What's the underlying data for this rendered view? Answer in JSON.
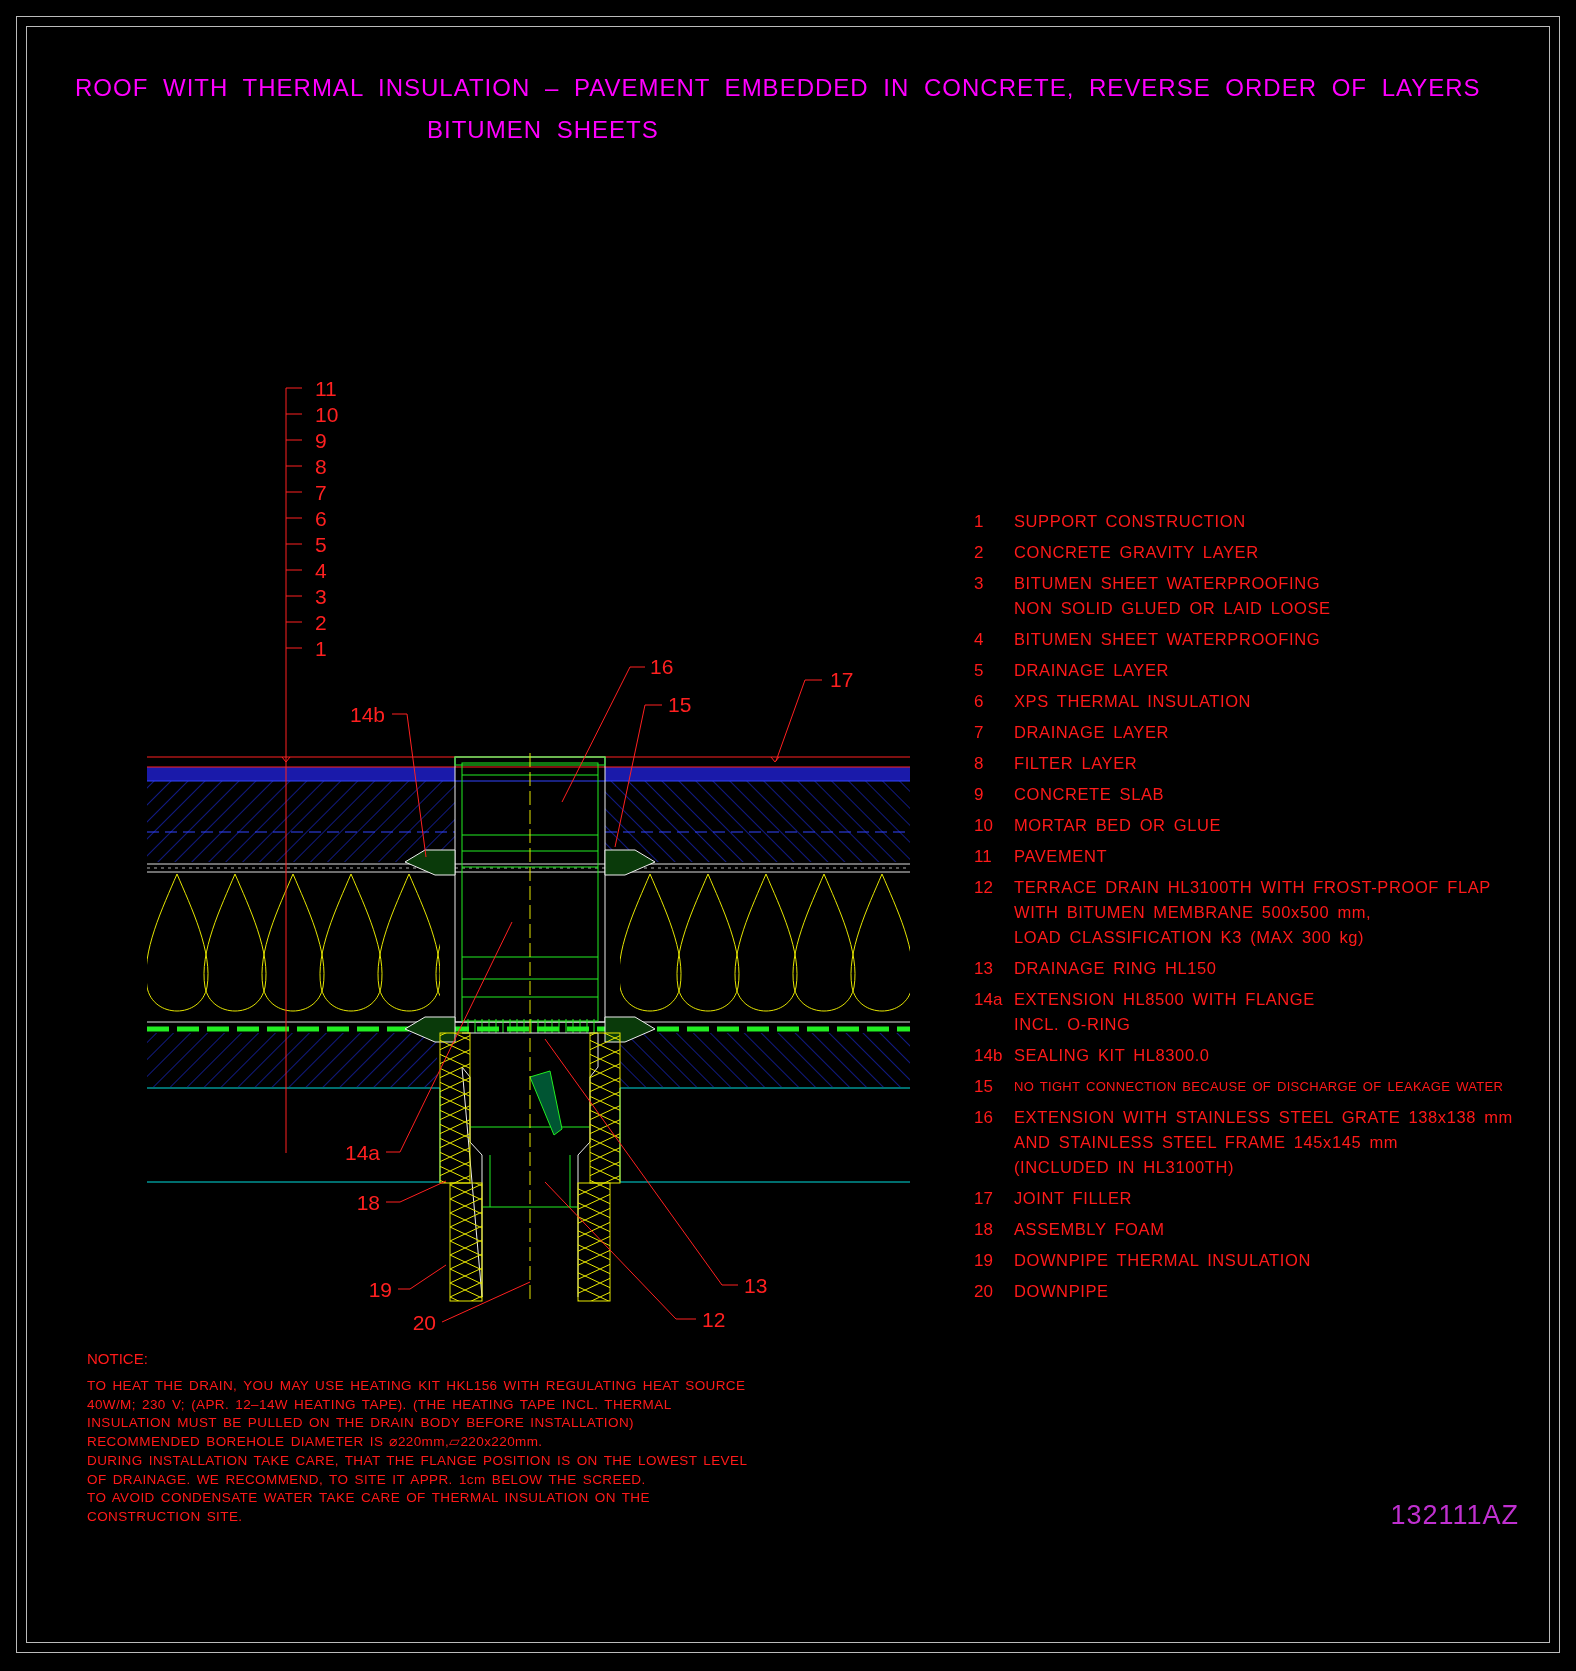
{
  "title": {
    "lines": [
      "ROOF WITH THERMAL INSULATION – PAVEMENT EMBEDDED IN CONCRETE, REVERSE ORDER OF LAYERS",
      "BITUMEN SHEETS"
    ]
  },
  "scale_labels": [
    "11",
    "10",
    "9",
    "8",
    "7",
    "6",
    "5",
    "4",
    "3",
    "2",
    "1"
  ],
  "callouts": [
    {
      "label": "16"
    },
    {
      "label": "15"
    },
    {
      "label": "17"
    },
    {
      "label": "14b"
    },
    {
      "label": "14a"
    },
    {
      "label": "18"
    },
    {
      "label": "19"
    },
    {
      "label": "20"
    },
    {
      "label": "13"
    },
    {
      "label": "12"
    }
  ],
  "legend": [
    {
      "number": "1",
      "kind": "normal",
      "lines": [
        "SUPPORT CONSTRUCTION"
      ]
    },
    {
      "number": "2",
      "kind": "normal",
      "lines": [
        "CONCRETE GRAVITY LAYER"
      ]
    },
    {
      "number": "3",
      "kind": "normal",
      "lines": [
        "BITUMEN SHEET WATERPROOFING",
        "NON SOLID GLUED OR LAID LOOSE"
      ]
    },
    {
      "number": "4",
      "kind": "normal",
      "lines": [
        "BITUMEN SHEET WATERPROOFING"
      ]
    },
    {
      "number": "5",
      "kind": "normal",
      "lines": [
        "DRAINAGE LAYER"
      ]
    },
    {
      "number": "6",
      "kind": "normal",
      "lines": [
        "XPS THERMAL INSULATION"
      ]
    },
    {
      "number": "7",
      "kind": "normal",
      "lines": [
        "DRAINAGE LAYER"
      ]
    },
    {
      "number": "8",
      "kind": "normal",
      "lines": [
        "FILTER LAYER"
      ]
    },
    {
      "number": "9",
      "kind": "normal",
      "lines": [
        "CONCRETE SLAB"
      ]
    },
    {
      "number": "10",
      "kind": "normal",
      "lines": [
        "MORTAR BED OR GLUE"
      ]
    },
    {
      "number": "11",
      "kind": "normal",
      "lines": [
        "PAVEMENT"
      ]
    },
    {
      "number": "12",
      "kind": "normal",
      "lines": [
        "TERRACE DRAIN HL3100TH WITH FROST-PROOF FLAP",
        "WITH BITUMEN MEMBRANE 500x500 mm,",
        "LOAD CLASSIFICATION K3 (MAX 300 kg)"
      ]
    },
    {
      "number": "13",
      "kind": "normal",
      "lines": [
        "DRAINAGE RING HL150"
      ]
    },
    {
      "number": "14a",
      "kind": "normal",
      "lines": [
        "EXTENSION HL8500 WITH FLANGE",
        "INCL. O-RING"
      ]
    },
    {
      "number": "14b",
      "kind": "normal",
      "lines": [
        "SEALING KIT HL8300.0"
      ]
    },
    {
      "number": "15",
      "kind": "fine",
      "lines": [
        "NO TIGHT CONNECTION BECAUSE OF DISCHARGE OF LEAKAGE WATER"
      ]
    },
    {
      "number": "16",
      "kind": "normal",
      "lines": [
        "EXTENSION WITH STAINLESS STEEL GRATE 138x138 mm",
        "AND STAINLESS STEEL FRAME 145x145 mm",
        "(INCLUDED IN HL3100TH)"
      ]
    },
    {
      "number": "17",
      "kind": "normal",
      "lines": [
        "JOINT FILLER"
      ]
    },
    {
      "number": "18",
      "kind": "normal",
      "lines": [
        "ASSEMBLY FOAM"
      ]
    },
    {
      "number": "19",
      "kind": "normal",
      "lines": [
        "DOWNPIPE THERMAL INSULATION"
      ]
    },
    {
      "number": "20",
      "kind": "normal",
      "lines": [
        "DOWNPIPE"
      ]
    }
  ],
  "notice": {
    "heading": "NOTICE:",
    "lines": [
      "TO HEAT THE DRAIN, YOU MAY USE HEATING KIT HKL156 WITH REGULATING HEAT SOURCE",
      "40W/M; 230 V;  (APR. 12–14W HEATING TAPE). (THE HEATING TAPE INCL. THERMAL",
      "INSULATION MUST BE PULLED ON THE DRAIN BODY BEFORE INSTALLATION)",
      "RECOMMENDED BOREHOLE DIAMETER IS ⌀220mm,▱220x220mm.",
      "DURING INSTALLATION TAKE CARE, THAT THE FLANGE POSITION IS ON THE LOWEST LEVEL",
      "OF DRAINAGE. WE RECOMMEND, TO SITE IT APPR. 1cm BELOW THE SCREED.",
      "TO AVOID CONDENSATE WATER TAKE CARE OF THERMAL INSULATION ON THE",
      "CONSTRUCTION SITE."
    ]
  },
  "drawing_code": "132111AZ"
}
